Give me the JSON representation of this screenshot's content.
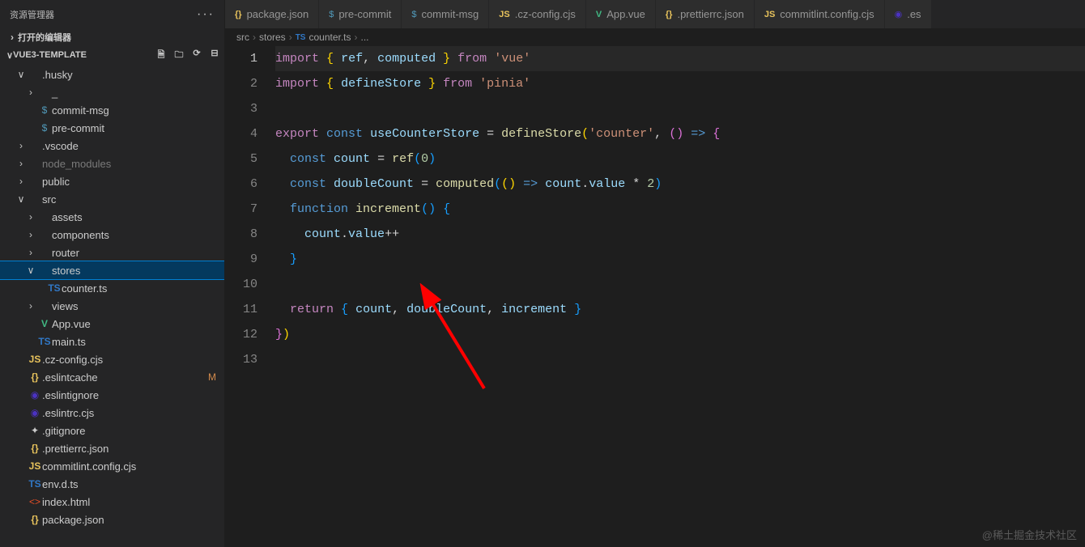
{
  "sidebar": {
    "title": "资源管理器",
    "open_editors": "打开的编辑器",
    "project": "VUE3-TEMPLATE",
    "action_icons": [
      "new-file-icon",
      "new-folder-icon",
      "refresh-icon",
      "collapse-icon"
    ]
  },
  "tree": [
    {
      "indent": 1,
      "chev": "∨",
      "icon": "",
      "cls": "",
      "label": ".husky"
    },
    {
      "indent": 2,
      "chev": "›",
      "icon": "",
      "cls": "",
      "label": "_"
    },
    {
      "indent": 2,
      "chev": "",
      "icon": "$",
      "cls": "ic-dollar",
      "label": "commit-msg"
    },
    {
      "indent": 2,
      "chev": "",
      "icon": "$",
      "cls": "ic-dollar",
      "label": "pre-commit"
    },
    {
      "indent": 1,
      "chev": "›",
      "icon": "",
      "cls": "",
      "label": ".vscode"
    },
    {
      "indent": 1,
      "chev": "›",
      "icon": "",
      "cls": "",
      "label": "node_modules",
      "dim": true
    },
    {
      "indent": 1,
      "chev": "›",
      "icon": "",
      "cls": "",
      "label": "public"
    },
    {
      "indent": 1,
      "chev": "∨",
      "icon": "",
      "cls": "",
      "label": "src"
    },
    {
      "indent": 2,
      "chev": "›",
      "icon": "",
      "cls": "",
      "label": "assets"
    },
    {
      "indent": 2,
      "chev": "›",
      "icon": "",
      "cls": "",
      "label": "components"
    },
    {
      "indent": 2,
      "chev": "›",
      "icon": "",
      "cls": "",
      "label": "router"
    },
    {
      "indent": 2,
      "chev": "∨",
      "icon": "",
      "cls": "",
      "label": "stores",
      "selected": true
    },
    {
      "indent": 3,
      "chev": "",
      "icon": "TS",
      "cls": "ic-ts",
      "label": "counter.ts"
    },
    {
      "indent": 2,
      "chev": "›",
      "icon": "",
      "cls": "",
      "label": "views"
    },
    {
      "indent": 2,
      "chev": "",
      "icon": "V",
      "cls": "ic-vue",
      "label": "App.vue"
    },
    {
      "indent": 2,
      "chev": "",
      "icon": "TS",
      "cls": "ic-ts",
      "label": "main.ts"
    },
    {
      "indent": 1,
      "chev": "",
      "icon": "JS",
      "cls": "ic-js",
      "label": ".cz-config.cjs"
    },
    {
      "indent": 1,
      "chev": "",
      "icon": "{}",
      "cls": "ic-json",
      "label": ".eslintcache",
      "badge": "M"
    },
    {
      "indent": 1,
      "chev": "",
      "icon": "◉",
      "cls": "ic-eslint",
      "label": ".eslintignore"
    },
    {
      "indent": 1,
      "chev": "",
      "icon": "◉",
      "cls": "ic-eslint",
      "label": ".eslintrc.cjs"
    },
    {
      "indent": 1,
      "chev": "",
      "icon": "✦",
      "cls": "",
      "label": ".gitignore"
    },
    {
      "indent": 1,
      "chev": "",
      "icon": "{}",
      "cls": "ic-json",
      "label": ".prettierrc.json"
    },
    {
      "indent": 1,
      "chev": "",
      "icon": "JS",
      "cls": "ic-js",
      "label": "commitlint.config.cjs"
    },
    {
      "indent": 1,
      "chev": "",
      "icon": "TS",
      "cls": "ic-ts",
      "label": "env.d.ts"
    },
    {
      "indent": 1,
      "chev": "",
      "icon": "<>",
      "cls": "ic-html",
      "label": "index.html"
    },
    {
      "indent": 1,
      "chev": "",
      "icon": "{}",
      "cls": "ic-json",
      "label": "package.json"
    }
  ],
  "tabs": [
    {
      "icon": "{}",
      "cls": "ic-json",
      "label": "package.json"
    },
    {
      "icon": "$",
      "cls": "ic-dollar",
      "label": "pre-commit"
    },
    {
      "icon": "$",
      "cls": "ic-dollar",
      "label": "commit-msg"
    },
    {
      "icon": "JS",
      "cls": "ic-js",
      "label": ".cz-config.cjs"
    },
    {
      "icon": "V",
      "cls": "ic-vue",
      "label": "App.vue"
    },
    {
      "icon": "{}",
      "cls": "ic-json",
      "label": ".prettierrc.json"
    },
    {
      "icon": "JS",
      "cls": "ic-js",
      "label": "commitlint.config.cjs"
    },
    {
      "icon": "◉",
      "cls": "ic-eslint",
      "label": ".es"
    }
  ],
  "breadcrumb": {
    "parts": [
      "src",
      "stores"
    ],
    "file_icon": "TS",
    "file": "counter.ts",
    "tail": "..."
  },
  "code": {
    "lines": [
      [
        [
          "kw",
          "import"
        ],
        [
          "pun",
          " "
        ],
        [
          "brace-y",
          "{"
        ],
        [
          "pun",
          " "
        ],
        [
          "var",
          "ref"
        ],
        [
          "pun",
          ", "
        ],
        [
          "var",
          "computed"
        ],
        [
          "pun",
          " "
        ],
        [
          "brace-y",
          "}"
        ],
        [
          "pun",
          " "
        ],
        [
          "kw",
          "from"
        ],
        [
          "pun",
          " "
        ],
        [
          "str",
          "'vue'"
        ]
      ],
      [
        [
          "kw",
          "import"
        ],
        [
          "pun",
          " "
        ],
        [
          "brace-y",
          "{"
        ],
        [
          "pun",
          " "
        ],
        [
          "var",
          "defineStore"
        ],
        [
          "pun",
          " "
        ],
        [
          "brace-y",
          "}"
        ],
        [
          "pun",
          " "
        ],
        [
          "kw",
          "from"
        ],
        [
          "pun",
          " "
        ],
        [
          "str",
          "'pinia'"
        ]
      ],
      [],
      [
        [
          "kw",
          "export"
        ],
        [
          "pun",
          " "
        ],
        [
          "blue",
          "const"
        ],
        [
          "pun",
          " "
        ],
        [
          "var",
          "useCounterStore"
        ],
        [
          "pun",
          " = "
        ],
        [
          "fn",
          "defineStore"
        ],
        [
          "brace-y",
          "("
        ],
        [
          "str",
          "'counter'"
        ],
        [
          "pun",
          ", "
        ],
        [
          "brace-p",
          "("
        ],
        [
          "brace-p",
          ")"
        ],
        [
          "pun",
          " "
        ],
        [
          "blue",
          "=>"
        ],
        [
          "pun",
          " "
        ],
        [
          "brace-p",
          "{"
        ]
      ],
      [
        [
          "pun",
          "  "
        ],
        [
          "blue",
          "const"
        ],
        [
          "pun",
          " "
        ],
        [
          "var",
          "count"
        ],
        [
          "pun",
          " = "
        ],
        [
          "fn",
          "ref"
        ],
        [
          "brace-b",
          "("
        ],
        [
          "num",
          "0"
        ],
        [
          "brace-b",
          ")"
        ]
      ],
      [
        [
          "pun",
          "  "
        ],
        [
          "blue",
          "const"
        ],
        [
          "pun",
          " "
        ],
        [
          "var",
          "doubleCount"
        ],
        [
          "pun",
          " = "
        ],
        [
          "fn",
          "computed"
        ],
        [
          "brace-b",
          "("
        ],
        [
          "brace-y",
          "("
        ],
        [
          "brace-y",
          ")"
        ],
        [
          "pun",
          " "
        ],
        [
          "blue",
          "=>"
        ],
        [
          "pun",
          " "
        ],
        [
          "var",
          "count"
        ],
        [
          "pun",
          "."
        ],
        [
          "var",
          "value"
        ],
        [
          "pun",
          " * "
        ],
        [
          "num",
          "2"
        ],
        [
          "brace-b",
          ")"
        ]
      ],
      [
        [
          "pun",
          "  "
        ],
        [
          "blue",
          "function"
        ],
        [
          "pun",
          " "
        ],
        [
          "fn",
          "increment"
        ],
        [
          "brace-b",
          "("
        ],
        [
          "brace-b",
          ")"
        ],
        [
          "pun",
          " "
        ],
        [
          "brace-b",
          "{"
        ]
      ],
      [
        [
          "pun",
          "    "
        ],
        [
          "var",
          "count"
        ],
        [
          "pun",
          "."
        ],
        [
          "var",
          "value"
        ],
        [
          "pun",
          "++"
        ]
      ],
      [
        [
          "pun",
          "  "
        ],
        [
          "brace-b",
          "}"
        ]
      ],
      [],
      [
        [
          "pun",
          "  "
        ],
        [
          "kw",
          "return"
        ],
        [
          "pun",
          " "
        ],
        [
          "brace-b",
          "{"
        ],
        [
          "pun",
          " "
        ],
        [
          "var",
          "count"
        ],
        [
          "pun",
          ", "
        ],
        [
          "var",
          "doubleCount"
        ],
        [
          "pun",
          ", "
        ],
        [
          "var",
          "increment"
        ],
        [
          "pun",
          " "
        ],
        [
          "brace-b",
          "}"
        ]
      ],
      [
        [
          "brace-p",
          "}"
        ],
        [
          "brace-y",
          ")"
        ]
      ],
      []
    ],
    "current_line": 1
  },
  "watermark": "@稀土掘金技术社区"
}
